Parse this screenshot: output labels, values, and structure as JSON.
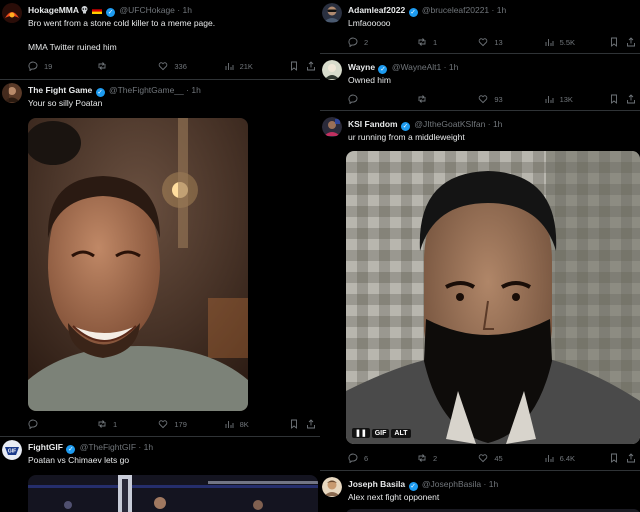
{
  "left_column": {
    "tweets": [
      {
        "name": "HokageMMA",
        "handle": "@UFCHokage",
        "time": "1h",
        "lines": [
          "Bro went from a stone cold killer to a meme page.",
          "MMA Twitter ruined him"
        ],
        "replies": "19",
        "retweets": "",
        "likes": "336",
        "views": "21K"
      },
      {
        "name": "The Fight Game",
        "handle": "@TheFightGame__",
        "time": "1h",
        "text": "Your so silly Poatan",
        "replies": "",
        "retweets": "1",
        "likes": "179",
        "views": "8K"
      },
      {
        "name": "FightGIF",
        "handle": "@TheFightGIF",
        "time": "1h",
        "text": "Poatan vs Chimaev lets go"
      }
    ]
  },
  "right_column": {
    "tweets": [
      {
        "name": "Adamleaf2022",
        "handle": "@bruceleaf20221",
        "time": "1h",
        "text": "Lmfaooooo",
        "replies": "2",
        "retweets": "1",
        "likes": "13",
        "views": "5.5K"
      },
      {
        "name": "Wayne",
        "handle": "@WayneAlt1",
        "time": "1h",
        "text": "Owned him",
        "replies": "",
        "retweets": "",
        "likes": "93",
        "views": "13K"
      },
      {
        "name": "KSI Fandom",
        "handle": "@JItheGoatKSIfan",
        "time": "1h",
        "text": "ur running from a middleweight",
        "replies": "6",
        "retweets": "2",
        "likes": "45",
        "views": "6.4K",
        "media_badges": [
          "❚❚",
          "GIF",
          "ALT"
        ]
      },
      {
        "name": "Joseph Basila",
        "handle": "@JosephBasila",
        "time": "1h",
        "text": "Alex next fight opponent"
      }
    ]
  },
  "colors": {
    "background": "#000000",
    "text": "#e7e9ea",
    "muted": "#71767b",
    "verified": "#1d9bf0",
    "divider": "#2f3336"
  }
}
